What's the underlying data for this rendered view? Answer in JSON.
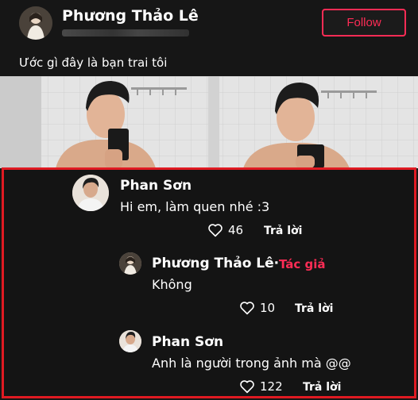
{
  "post": {
    "author_name": "Phương Thảo Lê",
    "follow_label": "Follow",
    "caption": "Ước gì đây là bạn trai tôi"
  },
  "comments": [
    {
      "name": "Phan Sơn",
      "text": "Hi em, làm quen nhé :3",
      "likes": "46",
      "reply_label": "Trả lời"
    },
    {
      "name": "Phương Thảo Lê·",
      "author_tag": "Tác giả",
      "text": "Không",
      "likes": "10",
      "reply_label": "Trả lời"
    },
    {
      "name": "Phan Sơn",
      "text": "Anh là người trong ảnh mà @@",
      "likes": "122",
      "reply_label": "Trả lời"
    }
  ],
  "colors": {
    "accent": "#fe2c55",
    "highlight_border": "#e01a22",
    "background": "#161616"
  },
  "icons": [
    "heart-icon"
  ]
}
